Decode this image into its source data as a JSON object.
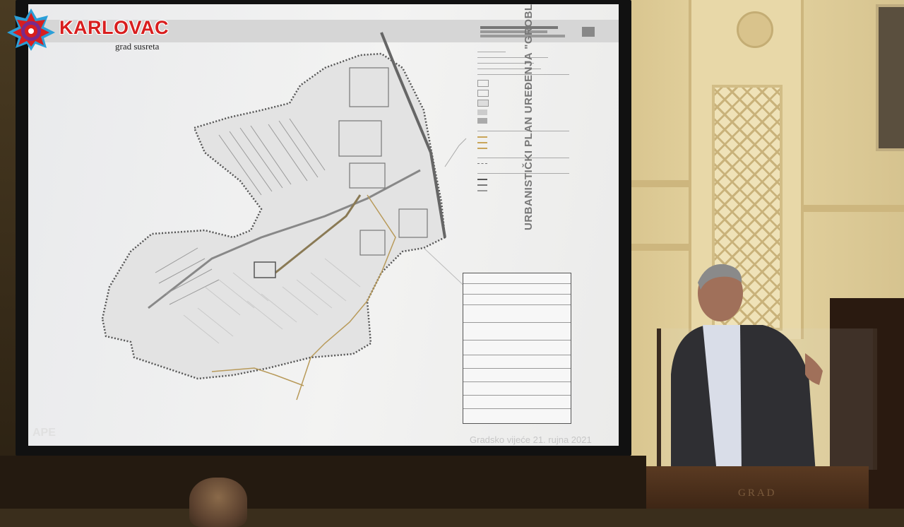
{
  "brand": {
    "name": "KARLOVAC",
    "tagline": "grad susreta",
    "accent_color": "#d81e1e"
  },
  "slide": {
    "vertical_title": "URBANISTIČKI PLAN UREĐENJA \"GROBLJE VELIKA ŠVARČA\"",
    "footer": "Gradsko vijeće 21. rujna 2021",
    "watermark": "APE"
  },
  "podium": {
    "label": "GRAD"
  }
}
